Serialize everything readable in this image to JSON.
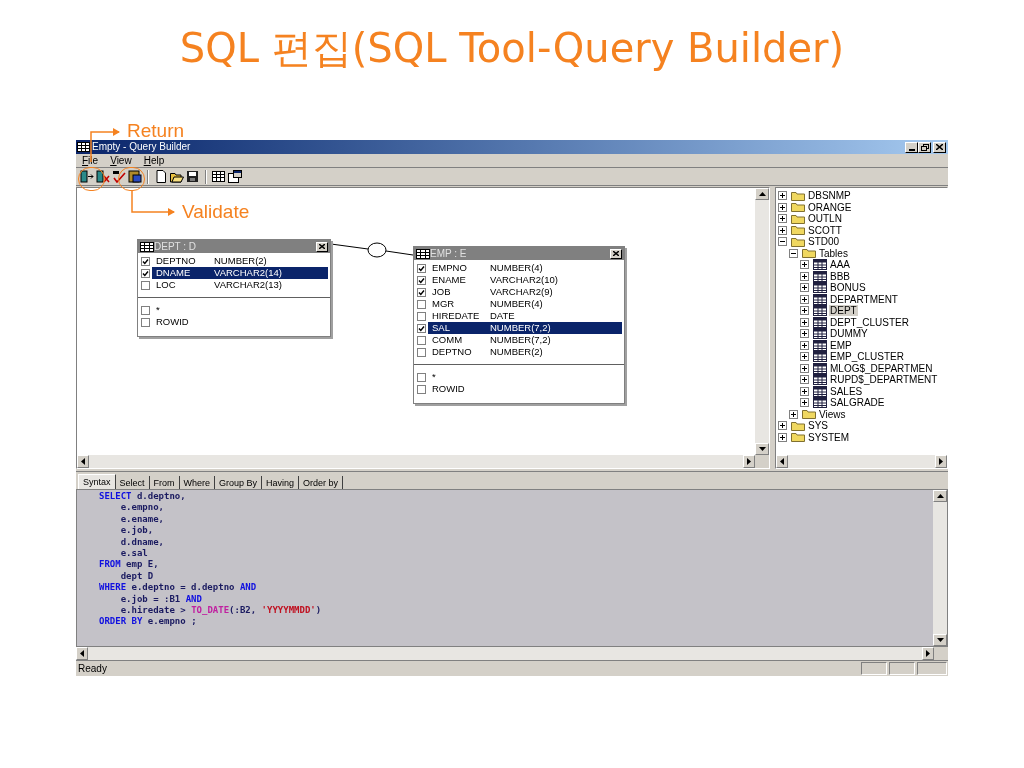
{
  "slide": {
    "title": "SQL 편집(SQL Tool-Query Builder)"
  },
  "annotations": [
    {
      "label": "Return"
    },
    {
      "label": "Validate"
    }
  ],
  "window": {
    "title": "Empty - Query Builder"
  },
  "menu": [
    {
      "label": "File"
    },
    {
      "label": "View"
    },
    {
      "label": "Help"
    }
  ],
  "diagram": {
    "tables": [
      {
        "title": "DEPT : D",
        "columns": [
          {
            "name": "DEPTNO",
            "type": "NUMBER(2)",
            "checked": true,
            "selected": false
          },
          {
            "name": "DNAME",
            "type": "VARCHAR2(14)",
            "checked": true,
            "selected": true
          },
          {
            "name": "LOC",
            "type": "VARCHAR2(13)",
            "checked": false,
            "selected": false
          }
        ],
        "extras": [
          {
            "name": "*",
            "checked": false
          },
          {
            "name": "ROWID",
            "checked": false
          }
        ]
      },
      {
        "title": "EMP : E",
        "columns": [
          {
            "name": "EMPNO",
            "type": "NUMBER(4)",
            "checked": true,
            "selected": false
          },
          {
            "name": "ENAME",
            "type": "VARCHAR2(10)",
            "checked": true,
            "selected": false
          },
          {
            "name": "JOB",
            "type": "VARCHAR2(9)",
            "checked": true,
            "selected": false
          },
          {
            "name": "MGR",
            "type": "NUMBER(4)",
            "checked": false,
            "selected": false
          },
          {
            "name": "HIREDATE",
            "type": "DATE",
            "checked": false,
            "selected": false
          },
          {
            "name": "SAL",
            "type": "NUMBER(7,2)",
            "checked": true,
            "selected": true
          },
          {
            "name": "COMM",
            "type": "NUMBER(7,2)",
            "checked": false,
            "selected": false
          },
          {
            "name": "DEPTNO",
            "type": "NUMBER(2)",
            "checked": false,
            "selected": false
          }
        ],
        "extras": [
          {
            "name": "*",
            "checked": false
          },
          {
            "name": "ROWID",
            "checked": false
          }
        ]
      }
    ]
  },
  "tree": [
    {
      "label": "DBSNMP",
      "kind": "folder",
      "expanded": false,
      "selected": false
    },
    {
      "label": "ORANGE",
      "kind": "folder",
      "expanded": false,
      "selected": false
    },
    {
      "label": "OUTLN",
      "kind": "folder",
      "expanded": false,
      "selected": false
    },
    {
      "label": "SCOTT",
      "kind": "folder",
      "expanded": false,
      "selected": false
    },
    {
      "label": "STD00",
      "kind": "folder",
      "expanded": true,
      "selected": false,
      "children": [
        {
          "label": "Tables",
          "kind": "folder",
          "expanded": true,
          "selected": false,
          "children": [
            {
              "label": "AAA",
              "kind": "table",
              "expanded": false,
              "selected": false
            },
            {
              "label": "BBB",
              "kind": "table",
              "expanded": false,
              "selected": false
            },
            {
              "label": "BONUS",
              "kind": "table",
              "expanded": false,
              "selected": false
            },
            {
              "label": "DEPARTMENT",
              "kind": "table",
              "expanded": false,
              "selected": false
            },
            {
              "label": "DEPT",
              "kind": "table",
              "expanded": false,
              "selected": true
            },
            {
              "label": "DEPT_CLUSTER",
              "kind": "table",
              "expanded": false,
              "selected": false
            },
            {
              "label": "DUMMY",
              "kind": "table",
              "expanded": false,
              "selected": false
            },
            {
              "label": "EMP",
              "kind": "table",
              "expanded": false,
              "selected": false
            },
            {
              "label": "EMP_CLUSTER",
              "kind": "table",
              "expanded": false,
              "selected": false
            },
            {
              "label": "MLOG$_DEPARTMEN",
              "kind": "table",
              "expanded": false,
              "selected": false
            },
            {
              "label": "RUPD$_DEPARTMENT",
              "kind": "table",
              "expanded": false,
              "selected": false
            },
            {
              "label": "SALES",
              "kind": "table",
              "expanded": false,
              "selected": false
            },
            {
              "label": "SALGRADE",
              "kind": "table",
              "expanded": false,
              "selected": false
            }
          ]
        },
        {
          "label": "Views",
          "kind": "folder",
          "expanded": false,
          "selected": false
        }
      ]
    },
    {
      "label": "SYS",
      "kind": "folder",
      "expanded": false,
      "selected": false
    },
    {
      "label": "SYSTEM",
      "kind": "folder",
      "expanded": false,
      "selected": false
    }
  ],
  "tabs": [
    {
      "label": "Syntax",
      "selected": true
    },
    {
      "label": "Select",
      "selected": false
    },
    {
      "label": "From",
      "selected": false
    },
    {
      "label": "Where",
      "selected": false
    },
    {
      "label": "Group By",
      "selected": false
    },
    {
      "label": "Having",
      "selected": false
    },
    {
      "label": "Order by",
      "selected": false
    }
  ],
  "sql": [
    [
      {
        "kind": "keyword",
        "text": "SELECT"
      },
      {
        "kind": "plain",
        "text": " d.deptno,"
      }
    ],
    [
      {
        "kind": "plain",
        "text": "    e.empno,"
      }
    ],
    [
      {
        "kind": "plain",
        "text": "    e.ename,"
      }
    ],
    [
      {
        "kind": "plain",
        "text": "    e.job,"
      }
    ],
    [
      {
        "kind": "plain",
        "text": "    d.dname,"
      }
    ],
    [
      {
        "kind": "plain",
        "text": "    e.sal"
      }
    ],
    [
      {
        "kind": "keyword",
        "text": "FROM"
      },
      {
        "kind": "plain",
        "text": " emp E,"
      }
    ],
    [
      {
        "kind": "plain",
        "text": "    dept D"
      }
    ],
    [
      {
        "kind": "keyword",
        "text": "WHERE"
      },
      {
        "kind": "plain",
        "text": " e.deptno = d.deptno "
      },
      {
        "kind": "keyword",
        "text": "AND"
      }
    ],
    [
      {
        "kind": "plain",
        "text": "    e.job = :B1 "
      },
      {
        "kind": "keyword",
        "text": "AND"
      }
    ],
    [
      {
        "kind": "plain",
        "text": "    e.hiredate > "
      },
      {
        "kind": "function",
        "text": "TO_DATE"
      },
      {
        "kind": "plain",
        "text": "(:B2, "
      },
      {
        "kind": "string",
        "text": "'YYYYMMDD'"
      },
      {
        "kind": "plain",
        "text": ")"
      }
    ],
    [
      {
        "kind": "keyword",
        "text": "ORDER BY"
      },
      {
        "kind": "plain",
        "text": " e.empno ;"
      }
    ]
  ],
  "status_bar": {
    "text": "Ready"
  }
}
